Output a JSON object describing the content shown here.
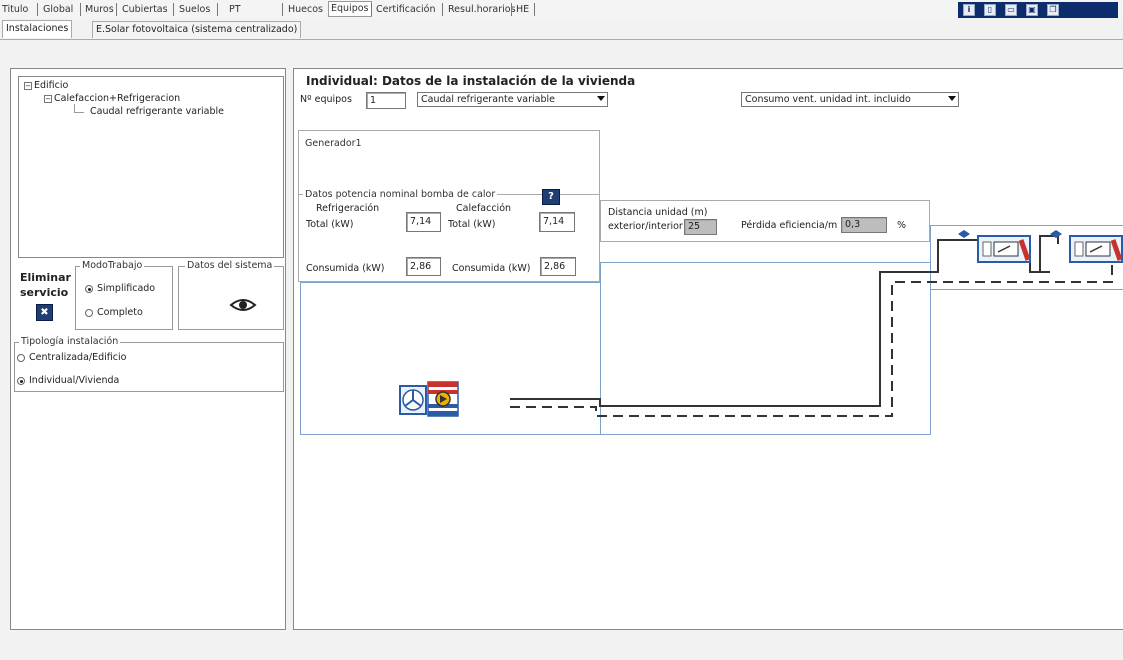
{
  "top_tabs": [
    "Titulo",
    "Global",
    "Muros",
    "Cubiertas",
    "Suelos",
    "PT",
    "Huecos",
    "Equipos",
    "Certificación",
    "Resul.horarios",
    "HE"
  ],
  "active_top_tab": "Equipos",
  "sub_tabs": [
    "Instalaciones",
    "E.Solar fotovoltaica (sistema centralizado)"
  ],
  "tree": {
    "root": "Edificio",
    "child": "Calefaccion+Refrigeracion",
    "leaf": "Caudal refrigerante variable"
  },
  "eliminar": {
    "line1": "Eliminar",
    "line2": "servicio"
  },
  "modo_trabajo": {
    "label": "ModoTrabajo",
    "options": [
      "Simplificado",
      "Completo"
    ],
    "selected": "Simplificado"
  },
  "datos_sistema": {
    "label": "Datos del sistema"
  },
  "tipologia": {
    "label": "Tipología instalación",
    "options": [
      "Centralizada/Edificio",
      "Individual/Vivienda"
    ],
    "selected": "Individual/Vivienda"
  },
  "main": {
    "title": "Individual: Datos de la instalación de la vivienda",
    "n_equipos_label": "Nº equipos",
    "n_equipos_value": "1",
    "system_select": "Caudal refrigerante variable",
    "consumo_select": "Consumo vent. unidad int. incluido",
    "generador_label": "Generador1",
    "potencia": {
      "label": "Datos potencia nominal bomba de calor",
      "refrigeracion": "Refrigeración",
      "calefaccion": "Calefacción",
      "total_label": "Total (kW)",
      "total_ref": "7,14",
      "total_cal": "7,14",
      "consumida_label": "Consumida (kW)",
      "consumida_ref": "2,86",
      "consumida_cal": "2,86"
    },
    "distancia": {
      "label_line1": "Distancia unidad (m)",
      "label_line2": "exterior/interior",
      "value": "25",
      "perdida_label": "Pérdida eficiencia/m",
      "perdida_value": "0,3",
      "unit": "%"
    }
  },
  "colors": {
    "icon_bar": "#0d2c6b",
    "unit_blue": "#2a5aa8",
    "unit_red": "#c8322c"
  }
}
